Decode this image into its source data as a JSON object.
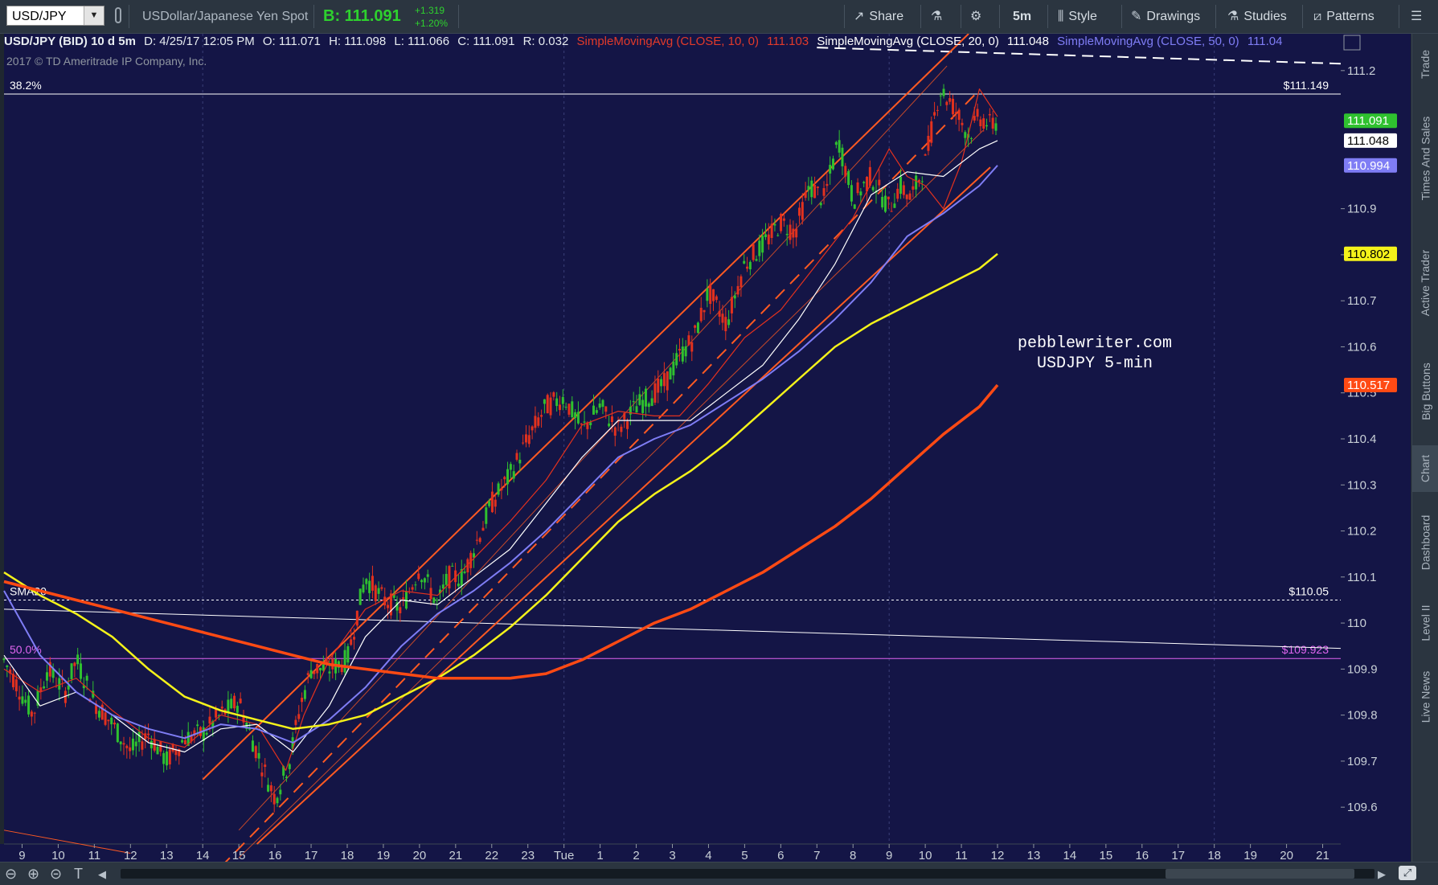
{
  "toolbar": {
    "symbol": "USD/JPY",
    "description": "USDollar/Japanese Yen Spot",
    "bid": "B: 111.091",
    "change_abs": "+1.319",
    "change_pct": "+1.20%",
    "buttons": {
      "share": "Share",
      "timeframe": "5m",
      "style": "Style",
      "drawings": "Drawings",
      "studies": "Studies",
      "patterns": "Patterns"
    }
  },
  "infobar": {
    "symbol": "USD/JPY (BID) 10 d 5m",
    "date": "D: 4/25/17 12:05 PM",
    "open": "O: 111.071",
    "high": "H: 111.098",
    "low": "L: 111.066",
    "close": "C: 111.091",
    "range": "R: 0.032",
    "sma10_label": "SimpleMovingAvg (CLOSE, 10, 0)",
    "sma10_value": "111.103",
    "sma20_label": "SimpleMovingAvg (CLOSE, 20, 0)",
    "sma20_value": "111.048",
    "sma50_label": "SimpleMovingAvg (CLOSE, 50, 0)",
    "sma50_value": "111.04"
  },
  "copyright": "2017 © TD Ameritrade IP Company, Inc.",
  "side_tabs": [
    "Trade",
    "Times And Sales",
    "Active Trader",
    "Big Buttons",
    "Chart",
    "Dashboard",
    "Level II",
    "Live News"
  ],
  "active_side_tab": "Chart",
  "colors": {
    "background": "#141546",
    "up_candle": "#2fc12f",
    "down_candle": "#e2311e",
    "sma10": "#e2311e",
    "sma20": "#ffffff",
    "sma50": "#7f7df5",
    "sma_yellow": "#f4f21a",
    "sma_orange": "#ff4a14",
    "channel": "#ff5a22",
    "fib": "#e065f0"
  },
  "chart_data": {
    "type": "line",
    "title": "USD/JPY (BID) 10 d 5m",
    "watermark_line1": "pebblewriter.com",
    "watermark_line2": "USDJPY 5-min",
    "xlabel": "",
    "ylabel": "",
    "x_ticks": [
      "9",
      "10",
      "11",
      "12",
      "13",
      "14",
      "15",
      "16",
      "17",
      "18",
      "19",
      "20",
      "21",
      "22",
      "23",
      "Tue",
      "1",
      "2",
      "3",
      "4",
      "5",
      "6",
      "7",
      "8",
      "9",
      "10",
      "11",
      "12",
      "13",
      "14",
      "15",
      "16",
      "17",
      "18",
      "19",
      "20",
      "21"
    ],
    "x_domain": [
      -0.5,
      36.5
    ],
    "ylim": [
      109.52,
      111.28
    ],
    "y_ticks": [
      109.6,
      109.7,
      109.8,
      109.9,
      110,
      110.1,
      110.2,
      110.3,
      110.4,
      110.5,
      110.6,
      110.7,
      110.8,
      110.9,
      111.2
    ],
    "y_tick_labels": [
      "109.6",
      "109.7",
      "109.8",
      "109.9",
      "110",
      "110.1",
      "110.2",
      "110.3",
      "110.4",
      "110.5",
      "110.6",
      "110.7",
      "110.8",
      "110.9",
      "111.2"
    ],
    "price_labels": [
      {
        "text": "111.091",
        "y": 111.091,
        "bg": "#2fc12f",
        "fg": "#ffffff"
      },
      {
        "text": "111.048",
        "y": 111.048,
        "bg": "#ffffff",
        "fg": "#000000"
      },
      {
        "text": "110.994",
        "y": 110.994,
        "bg": "#7f7df5",
        "fg": "#ffffff"
      },
      {
        "text": "110.802",
        "y": 110.802,
        "bg": "#f4f21a",
        "fg": "#000000"
      },
      {
        "text": "110.517",
        "y": 110.517,
        "bg": "#ff4a14",
        "fg": "#ffffff"
      }
    ],
    "horizontal_levels": [
      {
        "left_label": "38.2%",
        "right_label": "$111.149",
        "y": 111.149,
        "color": "#ffffff",
        "style": "solid"
      },
      {
        "left_label": "SMA20",
        "right_label": "$110.05",
        "y": 110.05,
        "color": "#ffffff",
        "style": "dotted"
      },
      {
        "left_label": "50.0%",
        "right_label": "$109.923",
        "y": 109.923,
        "color": "#e065f0",
        "style": "solid"
      }
    ],
    "trend_lines": [
      {
        "name": "",
        "x": [
          -0.5,
          36.5
        ],
        "y": [
          110.03,
          109.945
        ],
        "color": "#ffffff",
        "style": "solid"
      },
      {
        "name": "",
        "x": [
          22,
          36.5
        ],
        "y": [
          111.25,
          111.215
        ],
        "color": "#ffffff",
        "style": "dashed"
      },
      {
        "name": "",
        "x": [
          -0.5,
          3
        ],
        "y": [
          109.55,
          109.5
        ],
        "color": "#ff5a22",
        "style": "solid"
      }
    ],
    "channel_lines": [
      {
        "x": [
          5,
          26.2
        ],
        "y": [
          109.66,
          111.28
        ],
        "style": "solid",
        "width": 2
      },
      {
        "x": [
          5.5,
          26.4
        ],
        "y": [
          109.47,
          111.15
        ],
        "style": "dashed",
        "width": 2
      },
      {
        "x": [
          6,
          26.6
        ],
        "y": [
          109.49,
          111.07
        ],
        "style": "solid",
        "width": 1
      },
      {
        "x": [
          6.5,
          26.8
        ],
        "y": [
          109.52,
          110.99
        ],
        "style": "solid",
        "width": 2
      },
      {
        "x": [
          6,
          25.6
        ],
        "y": [
          109.55,
          111.21
        ],
        "style": "solid",
        "width": 1
      }
    ],
    "series": [
      {
        "name": "SimpleMovingAvg (CLOSE, 10, 0)",
        "color": "#e2311e",
        "x": [
          -0.5,
          0.5,
          1.5,
          2.5,
          3.5,
          4.5,
          5.5,
          6.5,
          7.3,
          7.8,
          8.5,
          9.5,
          10.5,
          11.5,
          12.5,
          13.5,
          14.5,
          15.5,
          16.5,
          17.5,
          18.2,
          19,
          20,
          21,
          22,
          23,
          24,
          24.5,
          25,
          25.5,
          26,
          26.5,
          27
        ],
        "y": [
          109.9,
          109.85,
          109.88,
          109.81,
          109.75,
          109.73,
          109.8,
          109.78,
          109.68,
          109.8,
          109.92,
          110.03,
          110.07,
          110.06,
          110.14,
          110.22,
          110.31,
          110.43,
          110.46,
          110.45,
          110.45,
          110.52,
          110.62,
          110.68,
          110.78,
          110.88,
          111.03,
          110.97,
          110.95,
          110.9,
          111.0,
          111.16,
          111.1
        ]
      },
      {
        "name": "SimpleMovingAvg (CLOSE, 20, 0)",
        "color": "#ffffff",
        "x": [
          -0.5,
          0.5,
          1.5,
          2.5,
          3.5,
          4.5,
          5.5,
          6.5,
          7.5,
          8.5,
          9.5,
          10.5,
          11.5,
          12.5,
          13.5,
          14.5,
          15.5,
          16.5,
          17.5,
          18.5,
          19.5,
          20.5,
          21.5,
          22.5,
          23.5,
          24.5,
          25.5,
          26.5,
          27
        ],
        "y": [
          109.93,
          109.82,
          109.85,
          109.8,
          109.74,
          109.72,
          109.77,
          109.78,
          109.72,
          109.82,
          109.97,
          110.05,
          110.04,
          110.1,
          110.16,
          110.26,
          110.36,
          110.44,
          110.44,
          110.44,
          110.5,
          110.56,
          110.66,
          110.78,
          110.93,
          110.98,
          110.97,
          111.03,
          111.048
        ]
      },
      {
        "name": "SimpleMovingAvg (CLOSE, 50, 0)",
        "color": "#7f7df5",
        "x": [
          -0.5,
          0.5,
          1.5,
          2.5,
          3.5,
          4.5,
          5.5,
          6.5,
          7.5,
          8.5,
          9.5,
          10.5,
          11.5,
          12.5,
          13.5,
          14.5,
          15.5,
          16.5,
          17.5,
          18.5,
          19.5,
          20.5,
          21.5,
          22.5,
          23.5,
          24.5,
          25.5,
          26.5,
          27
        ],
        "y": [
          110.07,
          109.93,
          109.85,
          109.8,
          109.77,
          109.75,
          109.78,
          109.77,
          109.74,
          109.79,
          109.86,
          109.95,
          110.02,
          110.07,
          110.13,
          110.2,
          110.28,
          110.36,
          110.4,
          110.43,
          110.48,
          110.53,
          110.59,
          110.66,
          110.74,
          110.84,
          110.89,
          110.95,
          110.994
        ]
      },
      {
        "name": "",
        "color": "#f4f21a",
        "x": [
          -0.5,
          0.5,
          1.5,
          2.5,
          3.5,
          4.5,
          5.5,
          6.5,
          7.5,
          8.5,
          9.5,
          10.5,
          11.5,
          12.5,
          13.5,
          14.5,
          15.5,
          16.5,
          17.5,
          18.5,
          19.5,
          20.5,
          21.5,
          22.5,
          23.5,
          24.5,
          25.5,
          26.5,
          27
        ],
        "y": [
          110.11,
          110.06,
          110.02,
          109.97,
          109.9,
          109.84,
          109.81,
          109.79,
          109.77,
          109.78,
          109.8,
          109.84,
          109.88,
          109.93,
          109.99,
          110.06,
          110.14,
          110.22,
          110.28,
          110.33,
          110.39,
          110.46,
          110.53,
          110.6,
          110.65,
          110.69,
          110.73,
          110.77,
          110.802
        ]
      },
      {
        "name": "",
        "color": "#ff4a14",
        "x": [
          -0.5,
          0.5,
          1.5,
          2.5,
          3.5,
          4.5,
          5.5,
          6.5,
          7.5,
          8.5,
          9.5,
          10.5,
          11.5,
          12.5,
          13.5,
          14.5,
          15.5,
          16.5,
          17.5,
          18.5,
          19.5,
          20.5,
          21.5,
          22.5,
          23.5,
          24.5,
          25.5,
          26.5,
          27
        ],
        "y": [
          110.09,
          110.07,
          110.05,
          110.03,
          110.01,
          109.99,
          109.97,
          109.95,
          109.93,
          109.91,
          109.9,
          109.89,
          109.88,
          109.88,
          109.88,
          109.89,
          109.92,
          109.96,
          110.0,
          110.03,
          110.07,
          110.11,
          110.16,
          110.21,
          110.27,
          110.34,
          110.41,
          110.47,
          110.517
        ]
      }
    ],
    "price_path": {
      "x": [
        -0.5,
        0.3,
        0.7,
        1.2,
        1.5,
        2.0,
        2.5,
        3.0,
        3.5,
        4.0,
        4.5,
        5.0,
        5.5,
        6.0,
        6.5,
        7.0,
        7.4,
        7.7,
        8.0,
        8.5,
        9.0,
        9.5,
        10.0,
        10.5,
        11.0,
        11.5,
        11.8,
        12.2,
        12.6,
        13.0,
        13.5,
        14.0,
        14.5,
        15.0,
        15.5,
        16.0,
        16.5,
        17.0,
        17.5,
        17.8,
        18.2,
        18.6,
        19.0,
        19.5,
        20.0,
        20.5,
        21.0,
        21.4,
        21.8,
        22.2,
        22.6,
        23.0,
        23.5,
        24.0,
        24.3,
        24.6,
        25.0,
        25.4,
        25.8,
        26.2,
        26.5,
        26.8,
        27.0
      ],
      "y": [
        109.92,
        109.8,
        109.9,
        109.85,
        109.92,
        109.83,
        109.78,
        109.72,
        109.76,
        109.7,
        109.75,
        109.76,
        109.8,
        109.83,
        109.72,
        109.62,
        109.7,
        109.82,
        109.9,
        109.9,
        109.92,
        110.1,
        110.05,
        110.03,
        110.12,
        110.04,
        110.1,
        110.1,
        110.18,
        110.26,
        110.32,
        110.4,
        110.47,
        110.49,
        110.42,
        110.47,
        110.42,
        110.47,
        110.5,
        110.52,
        110.58,
        110.62,
        110.72,
        110.65,
        110.78,
        110.82,
        110.87,
        110.85,
        110.95,
        110.92,
        111.05,
        110.92,
        110.97,
        110.9,
        110.95,
        110.92,
        111.0,
        111.16,
        111.12,
        111.06,
        111.1,
        111.08,
        111.091
      ]
    }
  }
}
